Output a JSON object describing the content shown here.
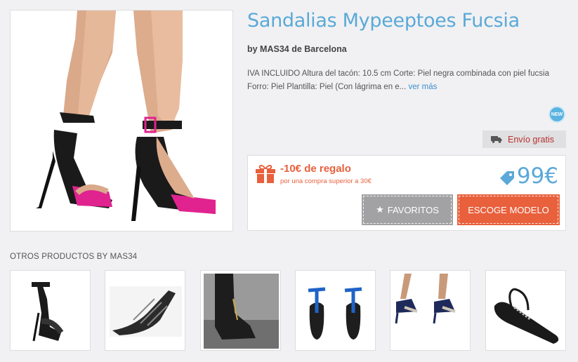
{
  "product": {
    "title": "Sandalias Mypeeptoes Fucsia",
    "brand_line": "by MAS34 de Barcelona",
    "description": "IVA INCLUIDO Altura del tacón: 10.5 cm Corte: Piel negra combinada con piel fucsia Forro: Piel Plantilla: Piel (Con lágrima en e...",
    "more_link": "ver más",
    "new_badge": "NEW",
    "shipping": "Envío gratis"
  },
  "buybox": {
    "gift_title": "-10€ de regalo",
    "gift_subtitle": "por una compra superior a 30€",
    "price": "99€",
    "favorites_label": "FAVORITOS",
    "choose_label": "ESCOGE MODELO"
  },
  "others": {
    "title": "OTROS PRODUCTOS BY MAS34",
    "items": [
      "product-1",
      "product-2",
      "product-3",
      "product-4",
      "product-5",
      "product-6"
    ]
  },
  "colors": {
    "accent_blue": "#5aa9d8",
    "accent_orange": "#e8603c",
    "shipping_red": "#b5312d",
    "fuchsia": "#e0238f"
  }
}
